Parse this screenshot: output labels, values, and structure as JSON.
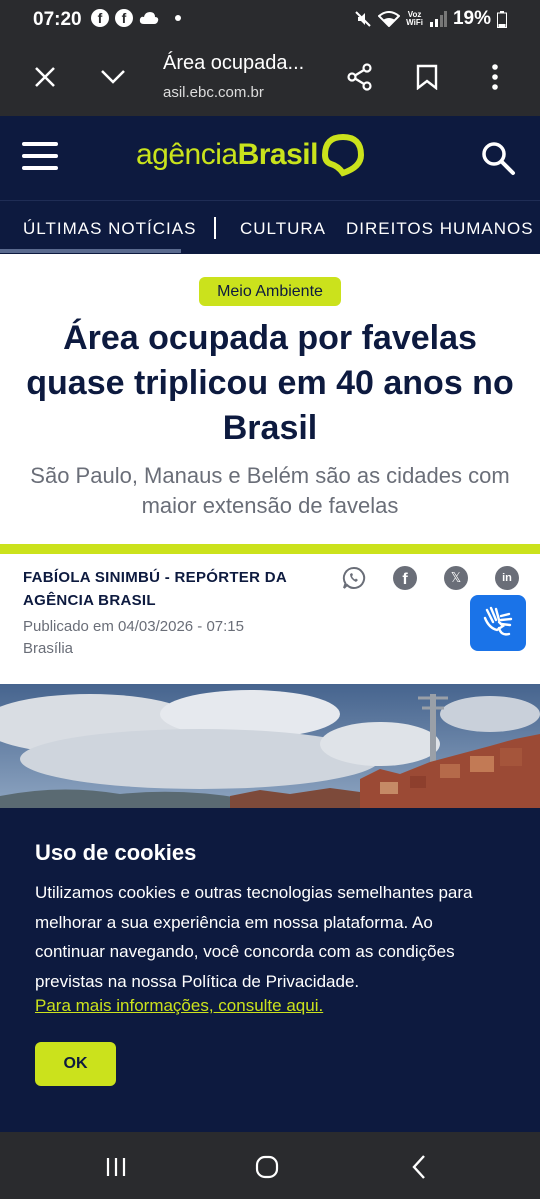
{
  "status_bar": {
    "time": "07:20",
    "battery": "19%",
    "voz_line1": "Voz",
    "voz_line2": "WiFi",
    "facebook_icon_text": "f"
  },
  "browser": {
    "title": "Área ocupada...",
    "url": "asil.ebc.com.br"
  },
  "site": {
    "logo_light": "agência",
    "logo_bold": "Brasil",
    "brand_color": "#cbe21c",
    "header_color": "#0d1a3f"
  },
  "nav": {
    "items": [
      "ÚLTIMAS NOTÍCIAS",
      "CULTURA",
      "DIREITOS HUMANOS"
    ]
  },
  "article": {
    "tag": "Meio Ambiente",
    "headline": "Área ocupada por favelas quase triplicou em 40 anos no Brasil",
    "subheadline": "São Paulo, Manaus e Belém são as cidades com maior extensão de favelas",
    "author": "FABÍOLA SINIMBÚ - REPÓRTER DA AGÊNCIA BRASIL",
    "published": "Publicado em 04/03/2026 - 07:15",
    "location": "Brasília"
  },
  "share": {
    "icons": [
      "whatsapp-icon",
      "facebook-icon",
      "x-icon",
      "linkedin-icon"
    ],
    "x_label": "𝕏",
    "facebook_label": "f",
    "linkedin_label": "in"
  },
  "cookie": {
    "title": "Uso de cookies",
    "body": "Utilizamos cookies e outras tecnologias semelhantes para melhorar a sua experiência em nossa plataforma. Ao continuar navegando, você concorda com as condições previstas na nossa Política de Privacidade.",
    "link": "Para mais informações, consulte aqui.",
    "ok_label": "OK"
  }
}
